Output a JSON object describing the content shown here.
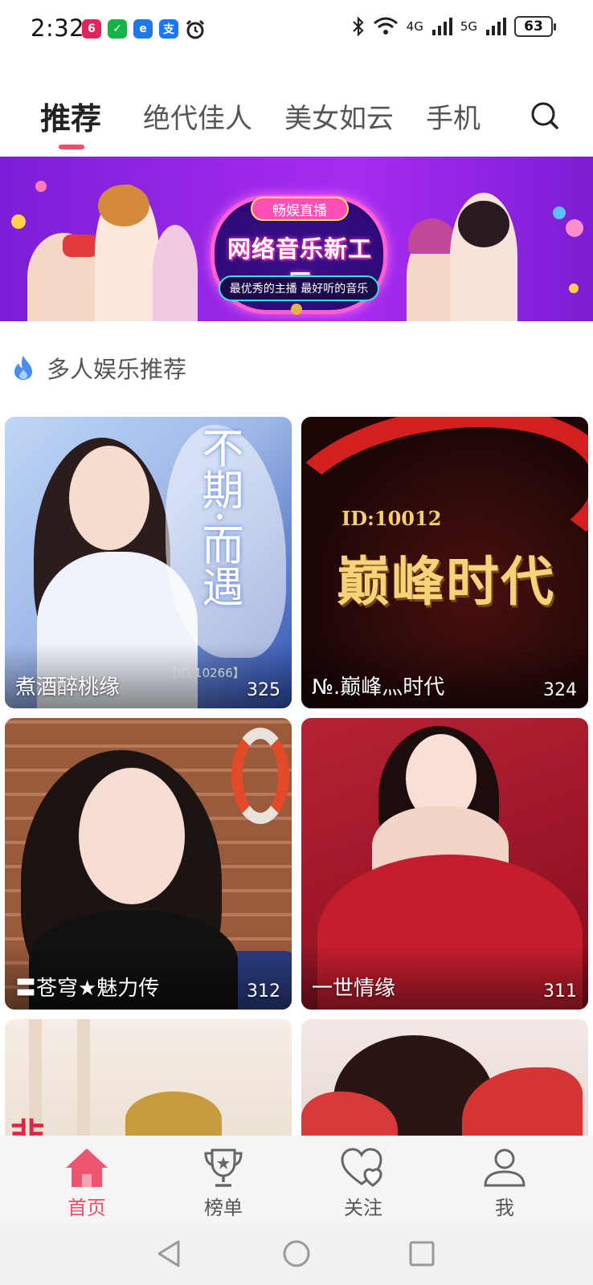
{
  "status_bar": {
    "time": "2:32",
    "apps": [
      {
        "label": "6",
        "color": "#e0245e"
      },
      {
        "label": "✓",
        "color": "#16b34a"
      },
      {
        "label": "e",
        "color": "#1e78e8"
      },
      {
        "label": "支",
        "color": "#1677ff"
      }
    ],
    "network_1": "4G",
    "network_2": "5G",
    "battery": "63"
  },
  "top_tabs": {
    "items": [
      {
        "label": "推荐",
        "active": true
      },
      {
        "label": "绝代佳人",
        "active": false
      },
      {
        "label": "美女如云",
        "active": false
      },
      {
        "label": "手机",
        "active": false
      }
    ]
  },
  "banner": {
    "pill": "畅娱直播",
    "title": "网络音乐新工厂",
    "subtitle": "最优秀的主播  最好听的音乐"
  },
  "section": {
    "title": "多人娱乐推荐"
  },
  "cards": [
    {
      "name": "煮酒醉桃缘",
      "count": "325",
      "art_title": "不期·而遇",
      "art_id": "【ID:10266】"
    },
    {
      "name": "№.巅峰灬时代",
      "count": "324",
      "art_title": "巅峰时代",
      "art_id": "ID:10012"
    },
    {
      "name": "〓苍穹★魅力传",
      "count": "312"
    },
    {
      "name": "一世情缘",
      "count": "311"
    },
    {
      "name": "",
      "count": ""
    },
    {
      "name": "",
      "count": ""
    }
  ],
  "bottom_nav": {
    "items": [
      {
        "label": "首页",
        "icon": "home-icon",
        "active": true
      },
      {
        "label": "榜单",
        "icon": "trophy-icon",
        "active": false
      },
      {
        "label": "关注",
        "icon": "heart-icon",
        "active": false
      },
      {
        "label": "我",
        "icon": "person-icon",
        "active": false
      }
    ]
  },
  "colors": {
    "accent": "#ee4d6b",
    "banner_purple": "#9b28e6",
    "fire_icon": "#3b82f6"
  }
}
